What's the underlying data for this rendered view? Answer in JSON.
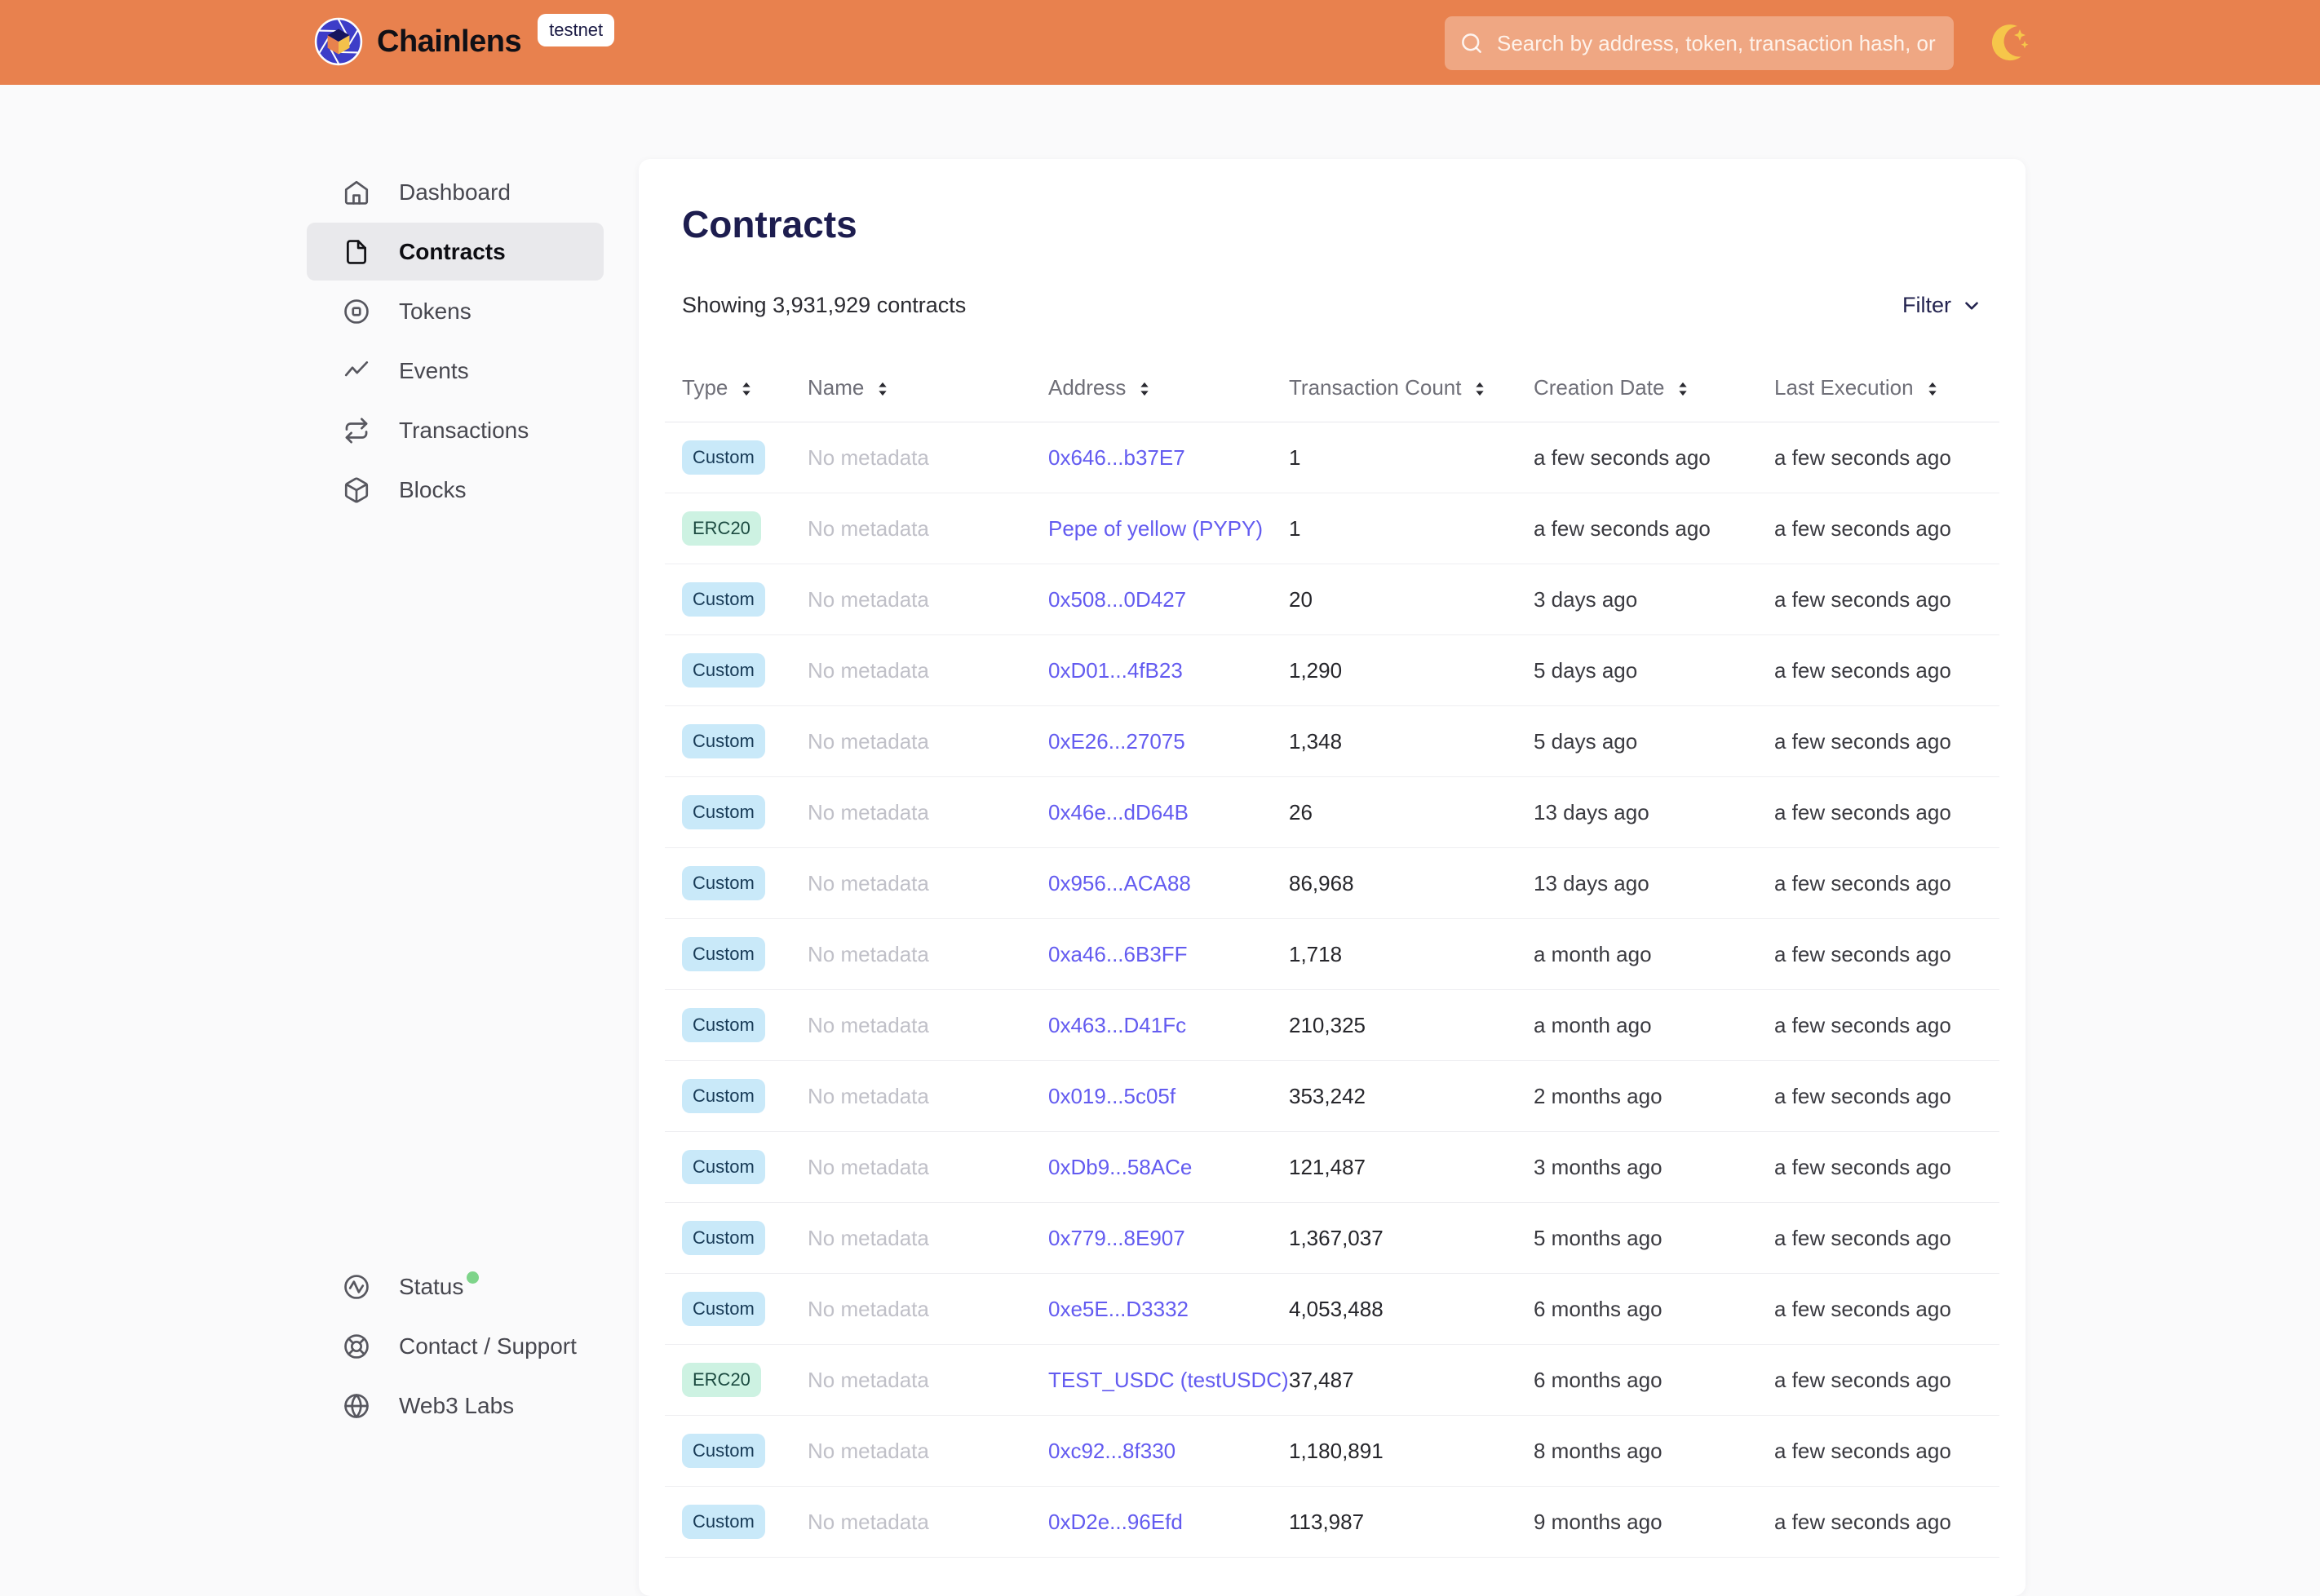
{
  "header": {
    "brand": "Chainlens",
    "env_badge": "testnet",
    "search_placeholder": "Search by address, token, transaction hash, or block number"
  },
  "sidebar": {
    "items": [
      {
        "label": "Dashboard",
        "icon": "home",
        "active": false
      },
      {
        "label": "Contracts",
        "icon": "file",
        "active": true
      },
      {
        "label": "Tokens",
        "icon": "token",
        "active": false
      },
      {
        "label": "Events",
        "icon": "activity",
        "active": false
      },
      {
        "label": "Transactions",
        "icon": "repeat",
        "active": false
      },
      {
        "label": "Blocks",
        "icon": "cube",
        "active": false
      }
    ],
    "footer_items": [
      {
        "label": "Status",
        "icon": "status",
        "status_dot": true
      },
      {
        "label": "Contact / Support",
        "icon": "support",
        "status_dot": false
      },
      {
        "label": "Web3 Labs",
        "icon": "globe",
        "status_dot": false
      }
    ]
  },
  "main": {
    "title": "Contracts",
    "summary": "Showing 3,931,929 contracts",
    "filter_label": "Filter",
    "table": {
      "columns": [
        {
          "label": "Type",
          "sortable": false
        },
        {
          "label": "Name",
          "sortable": false
        },
        {
          "label": "Address",
          "sortable": false
        },
        {
          "label": "Transaction Count",
          "sortable": true
        },
        {
          "label": "Creation Date",
          "sortable": true
        },
        {
          "label": "Last Execution",
          "sortable": true
        }
      ],
      "rows": [
        {
          "type": "Custom",
          "name": "No metadata",
          "address": "0x646...b37E7",
          "tx_count": "1",
          "creation": "a few seconds ago",
          "last_execution": "a few seconds ago"
        },
        {
          "type": "ERC20",
          "name": "No metadata",
          "address": "Pepe of yellow (PYPY)",
          "tx_count": "1",
          "creation": "a few seconds ago",
          "last_execution": "a few seconds ago"
        },
        {
          "type": "Custom",
          "name": "No metadata",
          "address": "0x508...0D427",
          "tx_count": "20",
          "creation": "3 days ago",
          "last_execution": "a few seconds ago"
        },
        {
          "type": "Custom",
          "name": "No metadata",
          "address": "0xD01...4fB23",
          "tx_count": "1,290",
          "creation": "5 days ago",
          "last_execution": "a few seconds ago"
        },
        {
          "type": "Custom",
          "name": "No metadata",
          "address": "0xE26...27075",
          "tx_count": "1,348",
          "creation": "5 days ago",
          "last_execution": "a few seconds ago"
        },
        {
          "type": "Custom",
          "name": "No metadata",
          "address": "0x46e...dD64B",
          "tx_count": "26",
          "creation": "13 days ago",
          "last_execution": "a few seconds ago"
        },
        {
          "type": "Custom",
          "name": "No metadata",
          "address": "0x956...ACA88",
          "tx_count": "86,968",
          "creation": "13 days ago",
          "last_execution": "a few seconds ago"
        },
        {
          "type": "Custom",
          "name": "No metadata",
          "address": "0xa46...6B3FF",
          "tx_count": "1,718",
          "creation": "a month ago",
          "last_execution": "a few seconds ago"
        },
        {
          "type": "Custom",
          "name": "No metadata",
          "address": "0x463...D41Fc",
          "tx_count": "210,325",
          "creation": "a month ago",
          "last_execution": "a few seconds ago"
        },
        {
          "type": "Custom",
          "name": "No metadata",
          "address": "0x019...5c05f",
          "tx_count": "353,242",
          "creation": "2 months ago",
          "last_execution": "a few seconds ago"
        },
        {
          "type": "Custom",
          "name": "No metadata",
          "address": "0xDb9...58ACe",
          "tx_count": "121,487",
          "creation": "3 months ago",
          "last_execution": "a few seconds ago"
        },
        {
          "type": "Custom",
          "name": "No metadata",
          "address": "0x779...8E907",
          "tx_count": "1,367,037",
          "creation": "5 months ago",
          "last_execution": "a few seconds ago"
        },
        {
          "type": "Custom",
          "name": "No metadata",
          "address": "0xe5E...D3332",
          "tx_count": "4,053,488",
          "creation": "6 months ago",
          "last_execution": "a few seconds ago"
        },
        {
          "type": "ERC20",
          "name": "No metadata",
          "address": "TEST_USDC (testUSDC)",
          "tx_count": "37,487",
          "creation": "6 months ago",
          "last_execution": "a few seconds ago"
        },
        {
          "type": "Custom",
          "name": "No metadata",
          "address": "0xc92...8f330",
          "tx_count": "1,180,891",
          "creation": "8 months ago",
          "last_execution": "a few seconds ago"
        },
        {
          "type": "Custom",
          "name": "No metadata",
          "address": "0xD2e...96Efd",
          "tx_count": "113,987",
          "creation": "9 months ago",
          "last_execution": "a few seconds ago"
        }
      ]
    }
  },
  "colors": {
    "header_bg": "#E8814E",
    "page_bg": "#FAFAFB",
    "link": "#635BF0",
    "status_dot": "#7ED48A",
    "badges": {
      "Custom": {
        "bg": "#C9E9F9",
        "fg": "#173A56"
      },
      "ERC20": {
        "bg": "#CDF2E2",
        "fg": "#1C4B41"
      }
    }
  }
}
